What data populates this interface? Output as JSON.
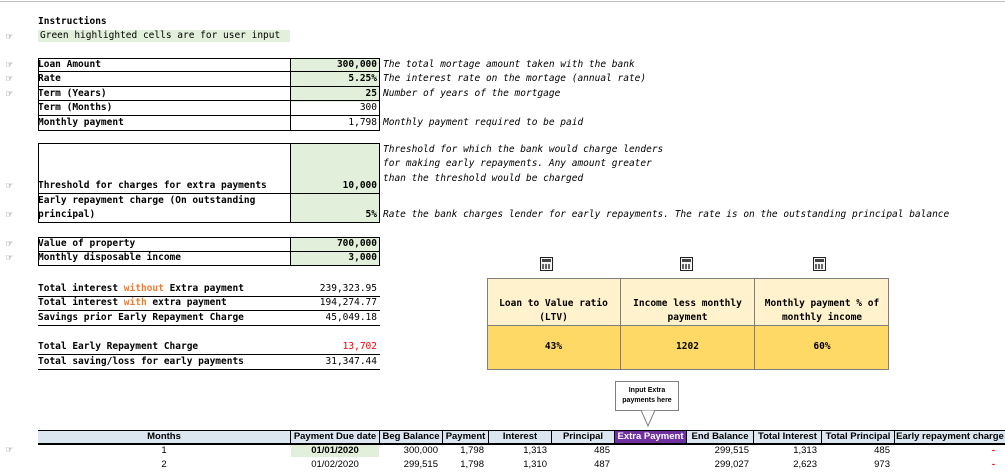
{
  "instructions": {
    "title": "Instructions",
    "hint": "Green highlighted cells are for user input"
  },
  "inputs": [
    {
      "label": "Loan Amount",
      "value": "300,000",
      "note": "The total mortage amount taken with the bank",
      "green": true,
      "bold": true
    },
    {
      "label": "Rate",
      "value": "5.25%",
      "note": "The interest rate on the mortage (annual rate)",
      "green": true,
      "bold": true
    },
    {
      "label": "Term (Years)",
      "value": "25",
      "note": "Number of years of the mortgage",
      "green": true,
      "bold": true
    },
    {
      "label": "Term (Months)",
      "value": "300",
      "note": "",
      "green": false,
      "bold": false
    },
    {
      "label": "Monthly payment",
      "value": "1,798",
      "note": "Monthly payment required to be paid",
      "green": false,
      "bold": false
    }
  ],
  "threshold": {
    "label": "Threshold for charges for extra payments",
    "value": "10,000",
    "note_lines": [
      "Threshold for which the bank would charge lenders",
      "for making early repayments. Any amount greater",
      "than the threshold would be charged"
    ]
  },
  "early_charge": {
    "label_line1": "Early repayment charge (On outstanding",
    "label_line2": "principal)",
    "value": "5%",
    "note": "Rate the bank charges lender for early repayments. The rate is on the outstanding principal balance"
  },
  "property": [
    {
      "label": "Value of property",
      "value": "700,000"
    },
    {
      "label": "Monthly disposable income",
      "value": "3,000"
    }
  ],
  "totals": {
    "interest_without": {
      "pre": "Total interest ",
      "hl": "without",
      "post": " Extra payment",
      "value": "239,323.95"
    },
    "interest_with": {
      "pre": "Total interest ",
      "hl": "with",
      "post": " extra payment",
      "value": "194,274.77"
    },
    "savings": {
      "label": "Savings prior Early Repayment Charge",
      "value": "45,049.18"
    },
    "early_charge_total": {
      "label": "Total Early Repayment Charge",
      "value": "13,702"
    },
    "net": {
      "label": "Total saving/loss for early payments",
      "value": "31,347.44"
    }
  },
  "kpis": [
    {
      "line1": "Loan to Value ratio",
      "line2": "(LTV)",
      "value": "43%"
    },
    {
      "line1": "Income less monthly",
      "line2": "payment",
      "value": "1202"
    },
    {
      "line1": "Monthly payment % of",
      "line2": "monthly income",
      "value": "60%"
    }
  ],
  "callout": {
    "line1": "Input Extra",
    "line2": "payments here"
  },
  "table": {
    "headers": [
      "Months",
      "Payment Due date",
      "Beg Balance",
      "Payment",
      "Interest",
      "Principal",
      "Extra Payment",
      "End Balance",
      "Total Interest",
      "Total Principal",
      "Early repayment charge"
    ],
    "rows": [
      [
        "1",
        "01/01/2020",
        "300,000",
        "1,798",
        "1,313",
        "485",
        "",
        "299,515",
        "1,313",
        "485",
        "-"
      ],
      [
        "2",
        "01/02/2020",
        "299,515",
        "1,798",
        "1,310",
        "487",
        "",
        "299,027",
        "2,623",
        "973",
        "-"
      ]
    ]
  },
  "icons": {
    "hand": "☞"
  },
  "colors": {
    "input_green": "#e2efda",
    "kpi_head": "#fff2cc",
    "kpi_value": "#ffd966",
    "extra_header": "#7030a0",
    "table_header": "#dce6f1",
    "highlight_orange": "#ed7d31",
    "negative_red": "#ff0000"
  }
}
